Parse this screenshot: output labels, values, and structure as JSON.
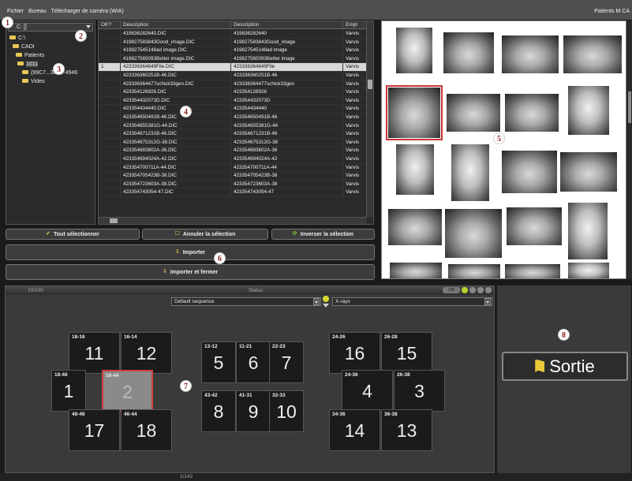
{
  "menubar": {
    "items": [
      "Fichier",
      "Bureau",
      "Télécharger de caméra (WIA)"
    ],
    "window_title": "Patients M CA"
  },
  "markers": [
    "1",
    "2",
    "3",
    "4",
    "5",
    "6",
    "7",
    "8"
  ],
  "tree": {
    "drive": "C: []",
    "items": [
      {
        "label": "C:\\",
        "indent": 0
      },
      {
        "label": "CADI",
        "indent": 1
      },
      {
        "label": "Patients",
        "indent": 2
      },
      {
        "label": "1011",
        "indent": 3
      },
      {
        "label": "{99C7...363E-4946",
        "indent": 4
      },
      {
        "label": "Video",
        "indent": 4
      }
    ]
  },
  "table": {
    "headers": [
      "OK?",
      "Description",
      "Description",
      "Empl"
    ],
    "rows": [
      [
        "",
        "419836282640.DIC",
        "419836282640",
        "Varvis"
      ],
      [
        "",
        "419827583843Good_image.DIC",
        "419827583843Good_image",
        "Varvis"
      ],
      [
        "",
        "419827545148ad image.DIC",
        "419827545148ad image",
        "Varvis"
      ],
      [
        "",
        "419827565093Better image.DIC",
        "419827565093Better image",
        "Varvis"
      ],
      [
        "1",
        "423336364649File.DIC",
        "423336364649File",
        "Varvis"
      ],
      [
        "",
        "423336360251B-46.DIC",
        "423336360251B-46",
        "Varvis"
      ],
      [
        "",
        "423336364477schick33gen.DIC",
        "423336364477schick33gen",
        "Varvis"
      ],
      [
        "",
        "423354126926.DIC",
        "423354126926",
        "Varvis"
      ],
      [
        "",
        "423354432073D.DIC",
        "423354432073D",
        "Varvis"
      ],
      [
        "",
        "423354434440.DIC",
        "423354434440",
        "Varvis"
      ],
      [
        "",
        "423354650491B-46.DIC",
        "423354650491B-46",
        "Varvis"
      ],
      [
        "",
        "423354655381G-44.DIC",
        "423354655381G-44",
        "Varvis"
      ],
      [
        "",
        "423354671231B-46.DIC",
        "423354671231B-46",
        "Varvis"
      ],
      [
        "",
        "423354675312G-38.DIC",
        "423354675312G-38",
        "Varvis"
      ],
      [
        "",
        "423354683802A-36.DIC",
        "423354683802A-36",
        "Varvis"
      ],
      [
        "",
        "423354694024A-42.DIC",
        "423354694024A-42",
        "Varvis"
      ],
      [
        "",
        "423354700711A-44.DIC",
        "423354700711A-44",
        "Varvis"
      ],
      [
        "",
        "423354705423B-38.DIC",
        "423354705423B-38",
        "Varvis"
      ],
      [
        "",
        "423354723603A-38.DIC",
        "423354723603A-38",
        "Varvis"
      ],
      [
        "",
        "423354743054-47.DIC",
        "423354743054-47",
        "Varvis"
      ]
    ],
    "selected_row": 4
  },
  "buttons": {
    "select_all": "Tout sélectionner",
    "cancel_selection": "Annuler la sélection",
    "invert_selection": "Inverser la sélection",
    "import": "Importer",
    "import_close": "Importer et fermer",
    "exit": "Sortie"
  },
  "status": {
    "counter": "10/100",
    "label": "Status",
    "pill": "100"
  },
  "sequence": {
    "selected": "Default sequence",
    "xray": "X-rays"
  },
  "teeth": [
    {
      "label": "18-16",
      "num": "11"
    },
    {
      "label": "16-14",
      "num": "12"
    },
    {
      "label": "18-46",
      "num": "1"
    },
    {
      "label": "16-44",
      "num": "2"
    },
    {
      "label": "48-46",
      "num": "17"
    },
    {
      "label": "46-44",
      "num": "18"
    },
    {
      "label": "13-12",
      "num": "5"
    },
    {
      "label": "11-21",
      "num": "6"
    },
    {
      "label": "22-23",
      "num": "7"
    },
    {
      "label": "43-42",
      "num": "8"
    },
    {
      "label": "41-31",
      "num": "9"
    },
    {
      "label": "32-33",
      "num": "10"
    },
    {
      "label": "24-26",
      "num": "16"
    },
    {
      "label": "26-28",
      "num": "15"
    },
    {
      "label": "24-36",
      "num": "4"
    },
    {
      "label": "26-38",
      "num": "3"
    },
    {
      "label": "34-36",
      "num": "14"
    },
    {
      "label": "36-38",
      "num": "13"
    }
  ],
  "footer": {
    "page": "1/142"
  },
  "colors": {
    "accent_red": "#d43c3c",
    "folder_yellow": "#e6c75a",
    "indicator_green": "#b6d32c"
  },
  "icons": [
    "folder-icon",
    "checkmark-icon",
    "arrow-import-icon",
    "refresh-icon",
    "door-exit-icon",
    "dropdown-arrow-icon"
  ]
}
